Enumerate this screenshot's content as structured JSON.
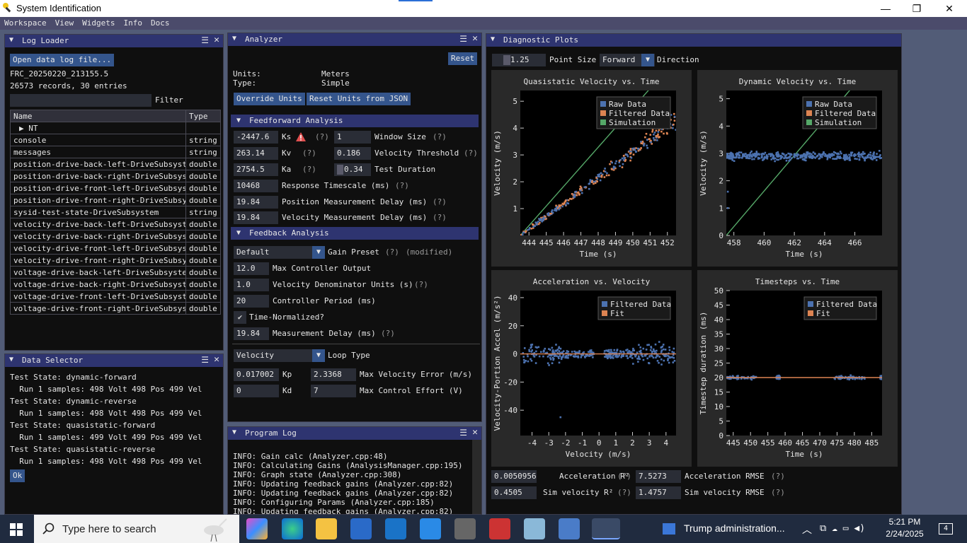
{
  "window": {
    "title": "System Identification",
    "min": "—",
    "max": "❐",
    "close": "✕"
  },
  "menu": [
    "Workspace",
    "View",
    "Widgets",
    "Info",
    "Docs"
  ],
  "log_loader": {
    "title": "Log Loader",
    "open_btn": "Open data log file...",
    "filename": "FRC_20250220_213155.5",
    "records": "26573 records, 30 entries",
    "filter_label": "Filter",
    "filter_value": "",
    "col_name": "Name",
    "col_type": "Type",
    "rows": [
      [
        "▶ NT",
        ""
      ],
      [
        "console",
        "string"
      ],
      [
        "messages",
        "string"
      ],
      [
        "position-drive-back-left-DriveSubsystem",
        "double"
      ],
      [
        "position-drive-back-right-DriveSubsystem",
        "double"
      ],
      [
        "position-drive-front-left-DriveSubsystem",
        "double"
      ],
      [
        "position-drive-front-right-DriveSubsystem",
        "double"
      ],
      [
        "sysid-test-state-DriveSubsystem",
        "string"
      ],
      [
        "velocity-drive-back-left-DriveSubsystem",
        "double"
      ],
      [
        "velocity-drive-back-right-DriveSubsystem",
        "double"
      ],
      [
        "velocity-drive-front-left-DriveSubsystem",
        "double"
      ],
      [
        "velocity-drive-front-right-DriveSubsystem",
        "double"
      ],
      [
        "voltage-drive-back-left-DriveSubsystem",
        "double"
      ],
      [
        "voltage-drive-back-right-DriveSubsystem",
        "double"
      ],
      [
        "voltage-drive-front-left-DriveSubsystem",
        "double"
      ],
      [
        "voltage-drive-front-right-DriveSubsystem",
        "double"
      ]
    ]
  },
  "data_selector": {
    "title": "Data Selector",
    "lines": [
      "Test State: dynamic-forward",
      "  Run 1 samples: 498 Volt 498 Pos 499 Vel",
      "Test State: dynamic-reverse",
      "  Run 1 samples: 498 Volt 498 Pos 499 Vel",
      "Test State: quasistatic-forward",
      "  Run 1 samples: 499 Volt 499 Pos 499 Vel",
      "Test State: quasistatic-reverse",
      "  Run 1 samples: 498 Volt 498 Pos 499 Vel"
    ],
    "ok": "Ok"
  },
  "analyzer": {
    "title": "Analyzer",
    "reset": "Reset",
    "units_label": "Units:",
    "units_value": "Meters",
    "type_label": "Type:",
    "type_value": "Simple",
    "override": "Override Units",
    "reset_json": "Reset Units from JSON",
    "ff_header": "Feedforward Analysis",
    "ks": "-2447.6",
    "ks_l": "Ks",
    "kv": "263.14",
    "kv_l": "Kv",
    "ka": "2754.5",
    "ka_l": "Ka",
    "q": "(?)",
    "window_size": "1",
    "window_size_l": "Window Size",
    "vel_thresh": "0.186",
    "vel_thresh_l": "Velocity Threshold",
    "test_dur": "0.34",
    "test_dur_l": "Test Duration",
    "resp_ts": "10468",
    "resp_ts_l": "Response Timescale (ms)",
    "pos_delay": "19.84",
    "pos_delay_l": "Position Measurement Delay (ms)",
    "vel_delay": "19.84",
    "vel_delay_l": "Velocity Measurement Delay (ms)",
    "fb_header": "Feedback Analysis",
    "preset": "Default",
    "preset_l": "Gain Preset",
    "modified": "(modified)",
    "max_out": "12.0",
    "max_out_l": "Max Controller Output",
    "vel_den": "1.0",
    "vel_den_l": "Velocity Denominator Units (s)",
    "period": "20",
    "period_l": "Controller Period (ms)",
    "time_norm_l": "Time-Normalized?",
    "meas_delay": "19.84",
    "meas_delay_l": "Measurement Delay (ms)",
    "loop": "Velocity",
    "loop_l": "Loop Type",
    "kp": "0.017002",
    "kp_l": "Kp",
    "kd": "0",
    "kd_l": "Kd",
    "max_vel_err": "2.3368",
    "max_vel_err_l": "Max Velocity Error (m/s)",
    "max_eff": "7",
    "max_eff_l": "Max Control Effort (V)"
  },
  "program_log": {
    "title": "Program Log",
    "lines": [
      "INFO: Gain calc (Analyzer.cpp:48)",
      "INFO: Calculating Gains (AnalysisManager.cpp:195)",
      "INFO: Graph state (Analyzer.cpp:308)",
      "INFO: Updating feedback gains (Analyzer.cpp:82)",
      "INFO: Updating feedback gains (Analyzer.cpp:82)",
      "INFO: Configuring Params (Analyzer.cpp:185)",
      "INFO: Updating feedback gains (Analyzer.cpp:82)"
    ]
  },
  "diag": {
    "title": "Diagnostic Plots",
    "point_size": "1.25",
    "point_size_l": "Point Size",
    "direction": "Forward",
    "direction_l": "Direction",
    "accel_r2": "0.0050956",
    "accel_r2_l": "Acceleration R²",
    "accel_rmse": "7.5273",
    "accel_rmse_l": "Acceleration RMSE",
    "sim_r2": "0.4505",
    "sim_r2_l": "Sim velocity R²",
    "sim_rmse": "1.4757",
    "sim_rmse_l": "Sim velocity RMSE"
  },
  "colors": {
    "raw": "#4c72b0",
    "filtered": "#dd8452",
    "sim": "#55a868",
    "fit": "#dd8452"
  },
  "chart_data": [
    {
      "type": "scatter",
      "title": "Quasistatic Velocity vs. Time",
      "xlabel": "Time (s)",
      "ylabel": "Velocity (m/s)",
      "xlim": [
        443.5,
        452.5
      ],
      "ylim": [
        0,
        5.4
      ],
      "xticks": [
        444,
        445,
        446,
        447,
        448,
        449,
        450,
        451,
        452
      ],
      "yticks": [
        1,
        2,
        3,
        4,
        5
      ],
      "legend": [
        "Raw Data",
        "Filtered Data",
        "Simulation"
      ],
      "legend_pos": "top-right"
    },
    {
      "type": "scatter",
      "title": "Dynamic Velocity vs. Time",
      "xlabel": "Time (s)",
      "ylabel": "Velocity (m/s)",
      "xlim": [
        457.5,
        467.8
      ],
      "ylim": [
        0,
        5.3
      ],
      "xticks": [
        458,
        460,
        462,
        464,
        466
      ],
      "yticks": [
        0,
        1,
        2,
        3,
        4,
        5
      ],
      "legend": [
        "Raw Data",
        "Filtered Data",
        "Simulation"
      ],
      "legend_pos": "top-right"
    },
    {
      "type": "scatter",
      "title": "Acceleration vs. Velocity",
      "xlabel": "Velocity (m/s)",
      "ylabel": "Velocity-Portion Accel (m/s²)",
      "xlim": [
        -4.7,
        4.6
      ],
      "ylim": [
        -58,
        45
      ],
      "xticks": [
        -4,
        -3,
        -2,
        -1,
        0,
        1,
        2,
        3,
        4
      ],
      "yticks": [
        -40,
        -20,
        0,
        20,
        40
      ],
      "legend": [
        "Filtered Data",
        "Fit"
      ],
      "legend_pos": "top-right"
    },
    {
      "type": "scatter",
      "title": "Timesteps vs. Time",
      "xlabel": "Time (s)",
      "ylabel": "Timestep duration (ms)",
      "xlim": [
        443,
        488
      ],
      "ylim": [
        0,
        50
      ],
      "xticks": [
        445,
        450,
        455,
        460,
        465,
        470,
        475,
        480,
        485
      ],
      "yticks": [
        0,
        5,
        10,
        15,
        20,
        25,
        30,
        35,
        40,
        45,
        50
      ],
      "legend": [
        "Filtered Data",
        "Fit"
      ],
      "legend_pos": "top-right"
    }
  ],
  "taskbar": {
    "search": "Type here to search",
    "news": "Trump administration...",
    "time": "5:21 PM",
    "date": "2/24/2025",
    "badge": "4"
  }
}
